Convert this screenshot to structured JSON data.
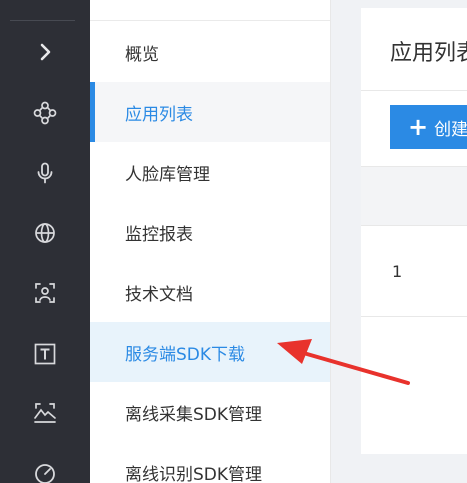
{
  "rail": {
    "icons": [
      "chevron-right-icon",
      "molecule-icon",
      "microphone-icon",
      "globe-icon",
      "face-scan-icon",
      "text-t-icon",
      "mountain-scan-icon",
      "gauge-icon"
    ]
  },
  "menu": {
    "items": [
      {
        "label": "概览"
      },
      {
        "label": "应用列表"
      },
      {
        "label": "人脸库管理"
      },
      {
        "label": "监控报表"
      },
      {
        "label": "技术文档"
      },
      {
        "label": "服务端SDK下载"
      },
      {
        "label": "离线采集SDK管理"
      },
      {
        "label": "离线识别SDK管理"
      }
    ]
  },
  "content": {
    "title": "应用列表",
    "create_button": "创建",
    "table": {
      "rows": [
        {
          "index": "1"
        }
      ]
    }
  },
  "colors": {
    "rail_bg": "#2d2f36",
    "accent": "#2b8ae4",
    "annotation_arrow": "#e8322c"
  }
}
